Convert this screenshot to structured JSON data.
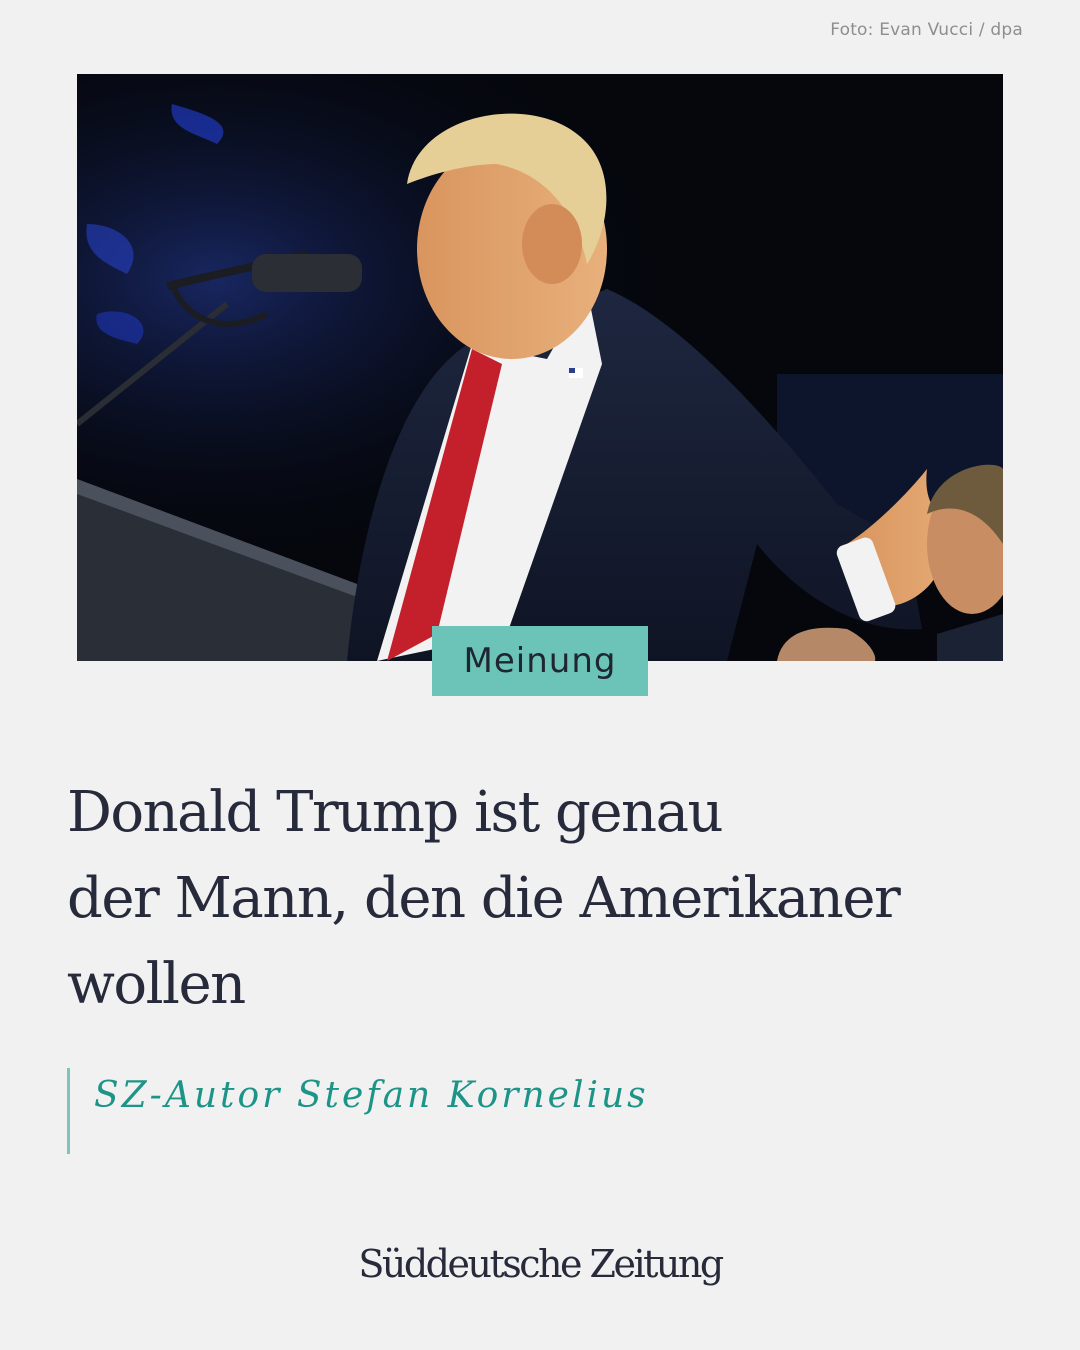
{
  "photo_credit": "Foto: Evan Vucci / dpa",
  "category_tag": "Meinung",
  "headline_lines": [
    "Donald Trump ist genau",
    "der Mann, den die Amerikaner",
    "wollen"
  ],
  "author_line": "SZ-Autor Stefan Kornelius",
  "brand": "Süddeutsche Zeitung",
  "colors": {
    "background": "#f1f1f1",
    "tag_background": "#6cc4b8",
    "accent_teal": "#1d9488",
    "text_dark": "#262a3a"
  }
}
